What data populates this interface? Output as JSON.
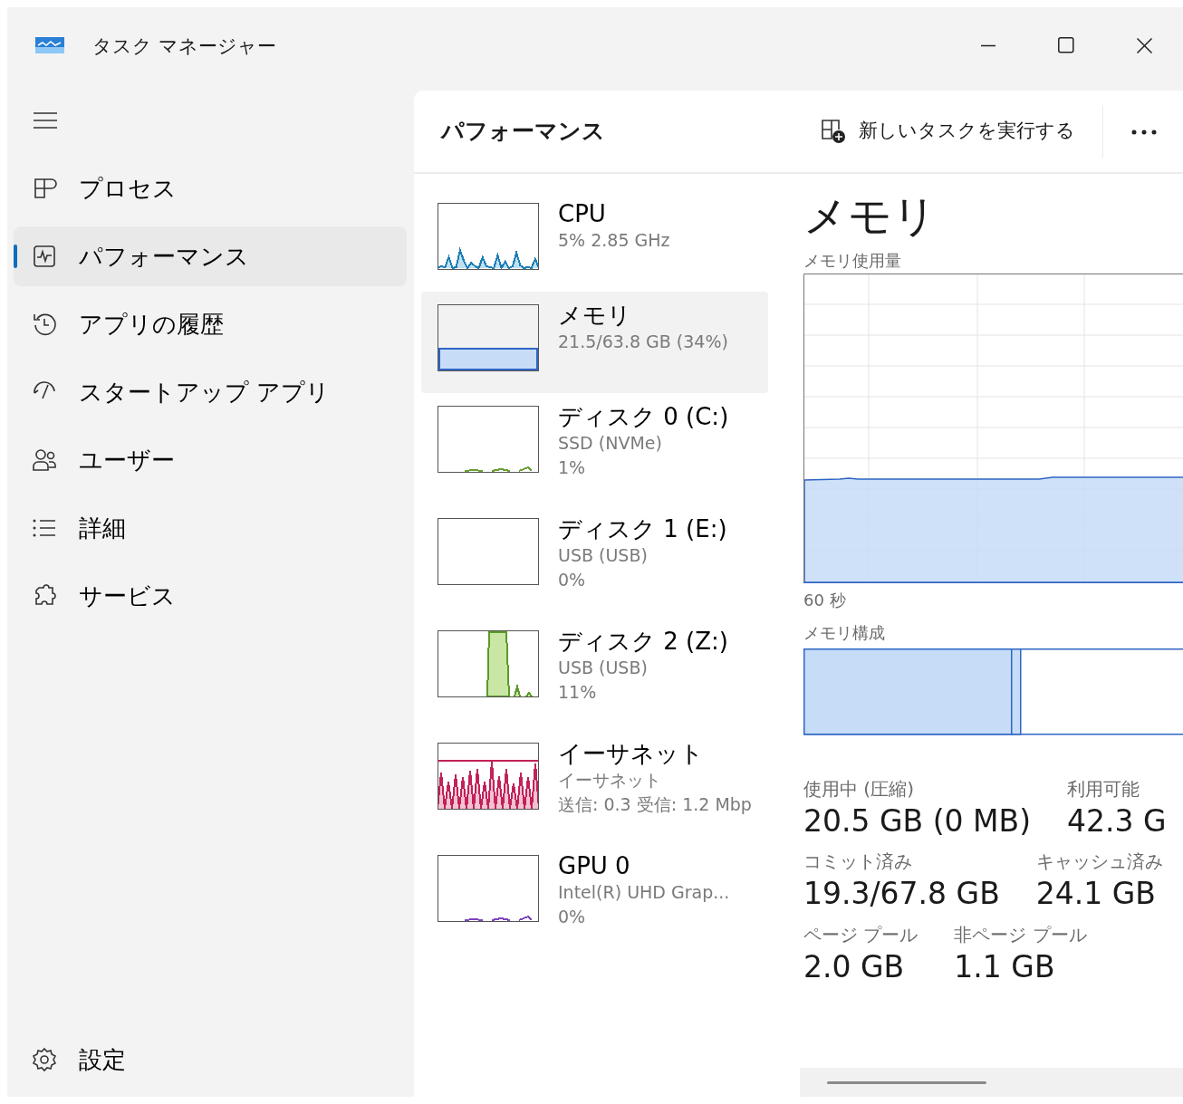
{
  "window": {
    "title": "タスク マネージャー"
  },
  "sidebar": {
    "items": [
      {
        "label": "プロセス",
        "selected": false
      },
      {
        "label": "パフォーマンス",
        "selected": true
      },
      {
        "label": "アプリの履歴",
        "selected": false
      },
      {
        "label": "スタートアップ アプリ",
        "selected": false
      },
      {
        "label": "ユーザー",
        "selected": false
      },
      {
        "label": "詳細",
        "selected": false
      },
      {
        "label": "サービス",
        "selected": false
      }
    ],
    "footer": {
      "label": "設定"
    }
  },
  "header": {
    "title": "パフォーマンス",
    "run_task_button": "新しいタスクを実行する"
  },
  "resources": [
    {
      "name": "CPU",
      "lines": [
        "5%  2.85 GHz"
      ],
      "kind": "line",
      "color": "#1c7fb6",
      "selected": false
    },
    {
      "name": "メモリ",
      "lines": [
        "21.5/63.8 GB (34%)"
      ],
      "kind": "fill",
      "color": "#2f66c4",
      "selected": true
    },
    {
      "name": "ディスク 0 (C:)",
      "lines": [
        "SSD (NVMe)",
        "1%"
      ],
      "kind": "dots",
      "color": "#6aa032",
      "selected": false
    },
    {
      "name": "ディスク 1 (E:)",
      "lines": [
        "USB (USB)",
        "0%"
      ],
      "kind": "empty",
      "selected": false
    },
    {
      "name": "ディスク 2 (Z:)",
      "lines": [
        "USB (USB)",
        "11%"
      ],
      "kind": "area",
      "color": "#5b9a2a",
      "selected": false
    },
    {
      "name": "イーサネット",
      "lines": [
        "イーサネット",
        "送信: 0.3 受信: 1.2 Mbp"
      ],
      "kind": "spikes",
      "color": "#c2215a",
      "selected": false
    },
    {
      "name": "GPU 0",
      "lines": [
        "Intel(R) UHD Grap...",
        "0%"
      ],
      "kind": "dots",
      "color": "#7b44bd",
      "selected": false
    }
  ],
  "detail": {
    "title": "メモリ",
    "usage_label": "メモリ使用量",
    "time_label": "60 秒",
    "composition_label": "メモリ構成",
    "stats": [
      [
        {
          "label": "使用中 (圧縮)",
          "value": "20.5 GB (0 MB)"
        },
        {
          "label": "利用可能",
          "value": "42.3 G"
        }
      ],
      [
        {
          "label": "コミット済み",
          "value": "19.3/67.8 GB"
        },
        {
          "label": "キャッシュ済み",
          "value": "24.1 GB"
        }
      ],
      [
        {
          "label": "ページ プール",
          "value": "2.0 GB"
        },
        {
          "label": "非ページ プール",
          "value": "1.1 GB"
        }
      ]
    ]
  }
}
